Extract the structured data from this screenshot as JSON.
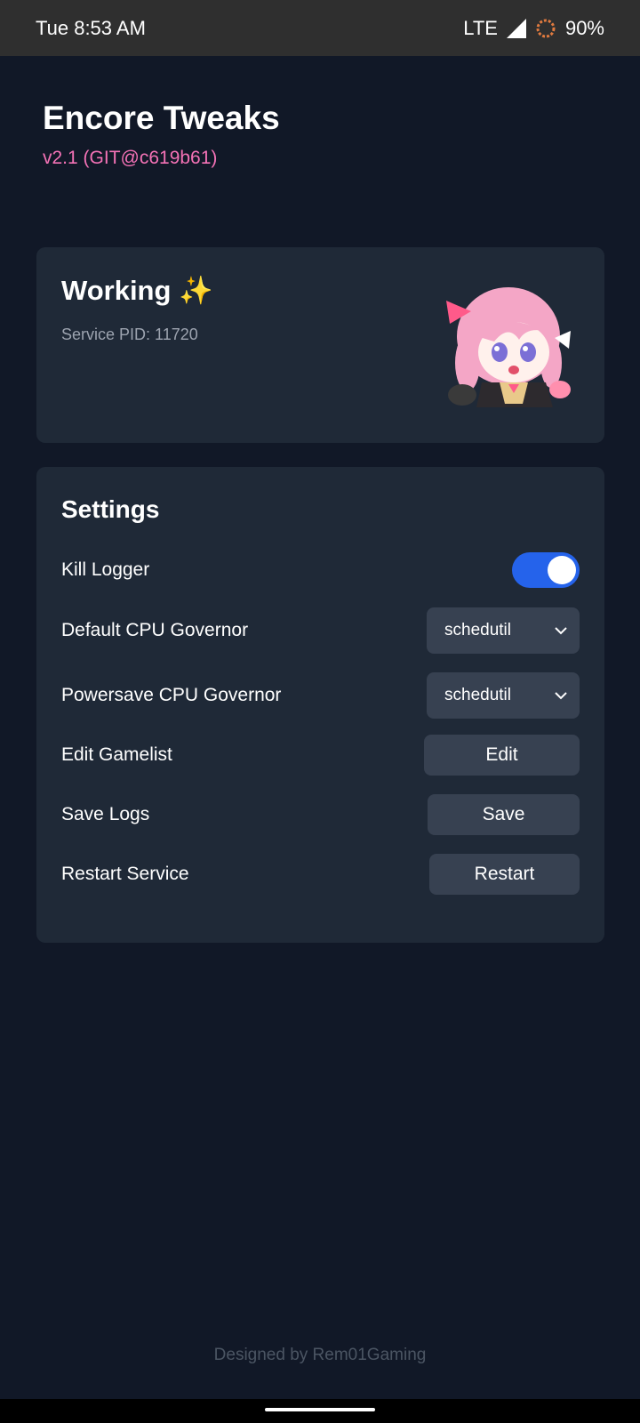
{
  "status_bar": {
    "time": "Tue 8:53 AM",
    "network": "LTE",
    "battery": "90%",
    "icons": [
      "signal-icon",
      "battery-saver-icon"
    ]
  },
  "header": {
    "title": "Encore Tweaks",
    "version": "v2.1 (GIT@c619b61)"
  },
  "status_card": {
    "title": "Working ✨",
    "pid": "Service PID: 11720",
    "image": "anime-mascot-icon"
  },
  "settings": {
    "title": "Settings",
    "kill_logger": {
      "label": "Kill Logger",
      "enabled": true
    },
    "default_governor": {
      "label": "Default CPU Governor",
      "value": "schedutil"
    },
    "powersave_governor": {
      "label": "Powersave CPU Governor",
      "value": "schedutil"
    },
    "edit_gamelist": {
      "label": "Edit Gamelist",
      "button": "Edit"
    },
    "save_logs": {
      "label": "Save Logs",
      "button": "Save"
    },
    "restart_service": {
      "label": "Restart Service",
      "button": "Restart"
    }
  },
  "footer": {
    "text": "Designed by Rem01Gaming"
  },
  "colors": {
    "background": "#111827",
    "card": "#1f2937",
    "accent": "#2563eb",
    "version": "#f472b6",
    "control": "#374151"
  }
}
